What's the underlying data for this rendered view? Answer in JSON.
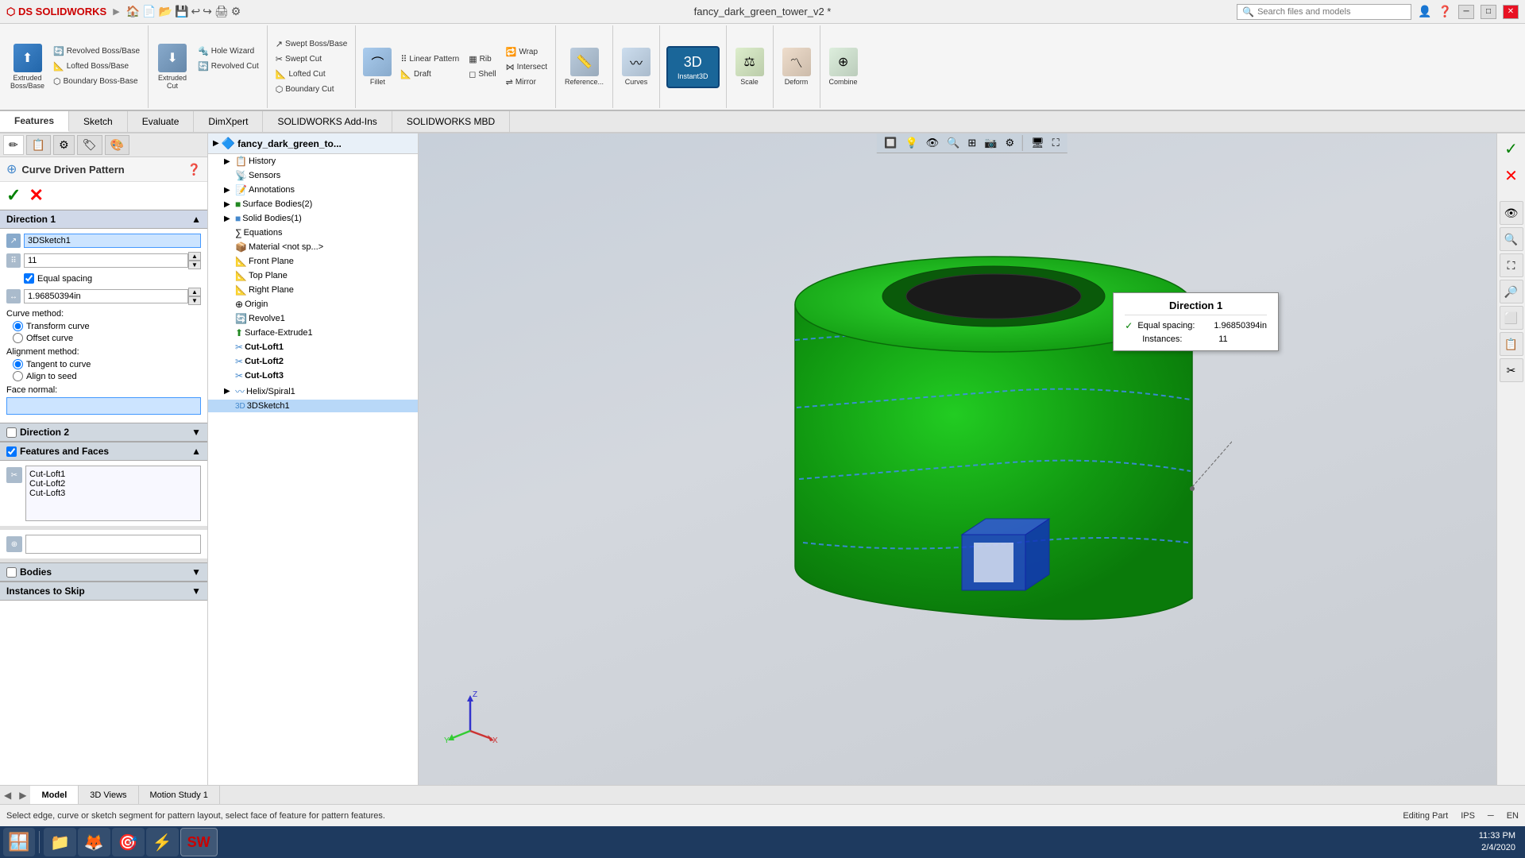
{
  "titlebar": {
    "logo": "DS SOLIDWORKS",
    "title": "fancy_dark_green_tower_v2 *",
    "search_placeholder": "Search files and models"
  },
  "quick_access": {
    "buttons": [
      "🏠",
      "📄",
      "💾",
      "↩",
      "↪",
      "🖨",
      "⚙"
    ]
  },
  "toolbar": {
    "sections": [
      {
        "name": "Extruded Boss/Base",
        "sub": [
          "Extruded Boss/Base"
        ],
        "small": [
          "Revolved Boss/Base",
          "Lofted Boss/Base",
          "Boundary Boss-Base"
        ]
      },
      {
        "name": "Extruded Cut",
        "small": [
          "Hole Wizard",
          "Revolved Cut"
        ]
      },
      {
        "name": "cuts",
        "small": [
          "Swept Boss/Base",
          "Swept Cut",
          "Lofted Cut",
          "Boundary Cut"
        ]
      },
      {
        "name": "features",
        "small": [
          "Fillet",
          "Linear Pattern",
          "Draft",
          "Rib",
          "Shell",
          "Wrap",
          "Intersect",
          "Mirror"
        ]
      },
      {
        "name": "Reference",
        "label": "Reference..."
      },
      {
        "name": "Curves",
        "label": "Curves"
      },
      {
        "name": "Instant3D",
        "label": "Instant3D",
        "highlighted": true
      },
      {
        "name": "Scale",
        "label": "Scale"
      },
      {
        "name": "Deform",
        "label": "Deform"
      },
      {
        "name": "Combine",
        "label": "Combine"
      }
    ]
  },
  "tabs": [
    "Features",
    "Sketch",
    "Evaluate",
    "DimXpert",
    "SOLIDWORKS Add-Ins",
    "SOLIDWORKS MBD"
  ],
  "active_tab": "Features",
  "panel_tabs": [
    "sketch",
    "evaluate",
    "dimxpert",
    "addins"
  ],
  "property_manager": {
    "title": "Curve Driven Pattern",
    "help_icon": "?",
    "sections": [
      {
        "name": "Direction 1",
        "fields": [
          {
            "label": "curve",
            "value": "3DSketch1",
            "type": "text-blue"
          },
          {
            "label": "instances",
            "value": "11",
            "type": "spin"
          },
          {
            "label": "equal_spacing",
            "checked": true,
            "label_text": "Equal spacing"
          },
          {
            "label": "spacing",
            "value": "1.96850394in",
            "type": "spin-in"
          }
        ],
        "curve_method": {
          "label": "Curve method:",
          "options": [
            "Transform curve",
            "Offset curve"
          ],
          "selected": "Transform curve"
        },
        "alignment_method": {
          "label": "Alignment method:",
          "options": [
            "Tangent to curve",
            "Align to seed"
          ],
          "selected": "Tangent to curve"
        },
        "face_normal": {
          "label": "Face normal:",
          "value": ""
        }
      },
      {
        "name": "Direction 2",
        "collapsed": true
      },
      {
        "name": "Features and Faces",
        "items": [
          "Cut-Loft1",
          "Cut-Loft2",
          "Cut-Loft3"
        ]
      },
      {
        "name": "Bodies",
        "collapsed": true
      },
      {
        "name": "Instances to Skip",
        "collapsed": false
      }
    ]
  },
  "feature_tree": {
    "root": "fancy_dark_green_to...",
    "items": [
      {
        "label": "History",
        "icon": "📋",
        "indent": 1,
        "arrow": true
      },
      {
        "label": "Sensors",
        "icon": "📡",
        "indent": 1,
        "arrow": false
      },
      {
        "label": "Annotations",
        "icon": "📝",
        "indent": 1,
        "arrow": true
      },
      {
        "label": "Surface Bodies(2)",
        "icon": "🟩",
        "indent": 1,
        "arrow": true
      },
      {
        "label": "Solid Bodies(1)",
        "icon": "🟦",
        "indent": 1,
        "arrow": true
      },
      {
        "label": "Equations",
        "icon": "=",
        "indent": 1,
        "arrow": false
      },
      {
        "label": "Material <not sp...",
        "icon": "📦",
        "indent": 1,
        "arrow": false
      },
      {
        "label": "Front Plane",
        "icon": "📐",
        "indent": 1,
        "arrow": false
      },
      {
        "label": "Top Plane",
        "icon": "📐",
        "indent": 1,
        "arrow": false
      },
      {
        "label": "Right Plane",
        "icon": "📐",
        "indent": 1,
        "arrow": false
      },
      {
        "label": "Origin",
        "icon": "⊕",
        "indent": 1,
        "arrow": false
      },
      {
        "label": "Revolve1",
        "icon": "🔄",
        "indent": 1,
        "arrow": false
      },
      {
        "label": "Surface-Extrude1",
        "icon": "⬆",
        "indent": 1,
        "arrow": false
      },
      {
        "label": "Cut-Loft1",
        "icon": "✂",
        "indent": 1,
        "arrow": false,
        "selected": false
      },
      {
        "label": "Cut-Loft2",
        "icon": "✂",
        "indent": 1,
        "arrow": false
      },
      {
        "label": "Cut-Loft3",
        "icon": "✂",
        "indent": 1,
        "arrow": false
      },
      {
        "label": "Helix/Spiral1",
        "icon": "〰",
        "indent": 1,
        "arrow": false
      },
      {
        "label": "3DSketch1",
        "icon": "📏",
        "indent": 1,
        "arrow": false,
        "selected": true
      }
    ]
  },
  "direction_callout": {
    "title": "Direction 1",
    "equal_spacing_label": "Equal spacing:",
    "equal_spacing_value": "1.96850394in",
    "instances_label": "Instances:",
    "instances_value": "11"
  },
  "viewport": {
    "axes": {
      "x": "X",
      "y": "Y",
      "z": "Z"
    }
  },
  "statusbar": {
    "message": "Select edge, curve or sketch segment for pattern layout, select face of feature for pattern features.",
    "editing": "Editing Part",
    "units": "IPS",
    "language": "EN"
  },
  "bottom_tabs": [
    "Model",
    "3D Views",
    "Motion Study 1"
  ],
  "active_bottom_tab": "Model",
  "taskbar": {
    "time": "11:33 PM",
    "date": "2/4/2020"
  }
}
